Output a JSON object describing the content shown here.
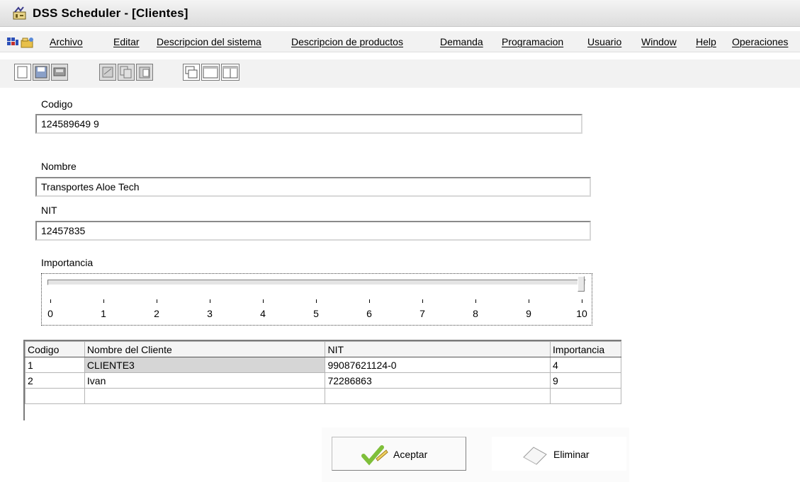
{
  "window": {
    "title": "DSS Scheduler  - [Clientes]",
    "app_icon": "scheduler-app-icon"
  },
  "menu": {
    "icons": [
      "mdi-window-icon",
      "folder-icon"
    ],
    "items": [
      "Archivo",
      "Editar",
      "Descripcion del sistema",
      "Descripcion de productos",
      "Demanda",
      "Programacion",
      "Usuario",
      "Window",
      "Help",
      "Operaciones"
    ]
  },
  "toolbar": {
    "icons": [
      "new-icon",
      "save-icon",
      "disk-icon",
      "cut-icon",
      "copy-icon",
      "paste-icon",
      "window-cascade-icon",
      "window-tile-icon",
      "window-split-icon"
    ]
  },
  "form": {
    "codigo_label": "Codigo",
    "codigo_value": "124589649 9",
    "nombre_label": "Nombre",
    "nombre_value": "Transportes Aloe Tech",
    "nit_label": "NIT",
    "nit_value": "12457835",
    "importancia_label": "Importancia",
    "importancia_value": 10,
    "importancia_min": 0,
    "importancia_max": 10,
    "tick_labels": [
      "0",
      "1",
      "2",
      "3",
      "4",
      "5",
      "6",
      "7",
      "8",
      "9",
      "10"
    ]
  },
  "table": {
    "columns": [
      "Codigo",
      "Nombre del Cliente",
      "NIT",
      "Importancia"
    ],
    "rows": [
      [
        "1",
        "CLIENTE3",
        "99087621124-0",
        "4"
      ],
      [
        "2",
        "Ivan",
        "72286863",
        "9"
      ],
      [
        "",
        "",
        "",
        ""
      ]
    ]
  },
  "buttons": {
    "aceptar": "Aceptar",
    "aceptar_icon": "checkmark-pencil-icon",
    "eliminar": "Eliminar",
    "eliminar_icon": "eraser-icon"
  },
  "colors": {
    "window_bg": "#ffffff",
    "chrome_bg": "#f2f2f2"
  }
}
